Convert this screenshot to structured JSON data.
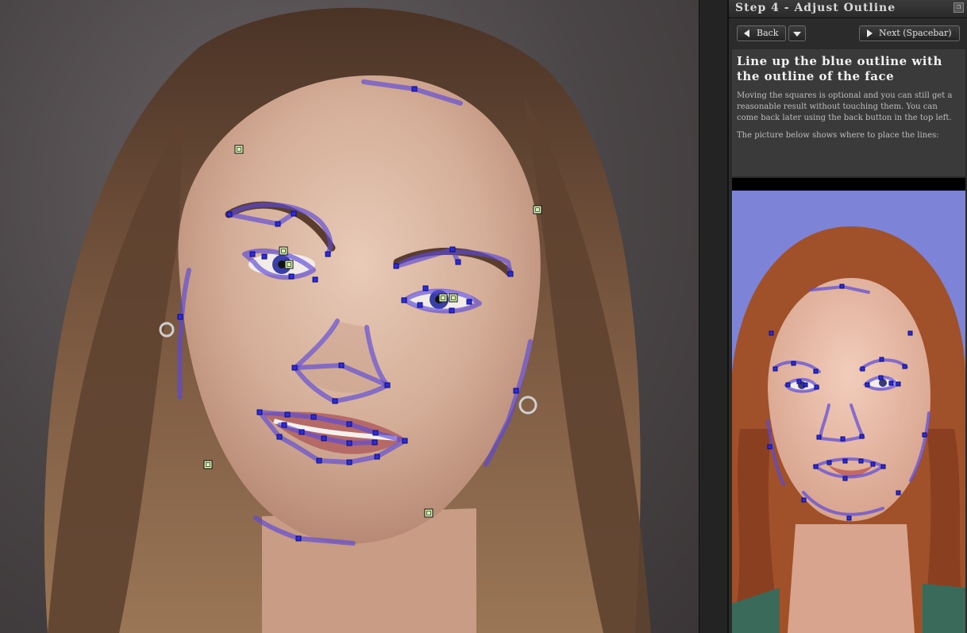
{
  "panel": {
    "title": "Step 4 - Adjust Outline",
    "restore_icon": "restore-icon"
  },
  "toolbar": {
    "back_label": "Back",
    "next_label": "Next (Spacebar)"
  },
  "instructions": {
    "heading": "Line up the blue outline with the outline of the face",
    "paragraph1": "Moving the squares is optional and you can still get a reasonable result without touching them. You can come back later using the back button in the top left.",
    "paragraph2": "The picture below shows where to place the lines:"
  },
  "colors": {
    "outline": "#5a48d8",
    "handle": "#d6ecb4",
    "panel_bg": "#2b2b2b",
    "reference_bg": "#7d84d8"
  }
}
